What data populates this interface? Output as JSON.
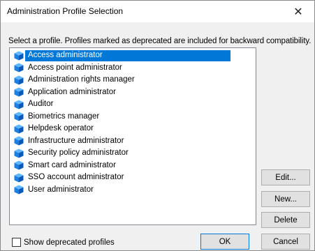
{
  "window": {
    "title": "Administration Profile Selection"
  },
  "instructions": "Select a profile.  Profiles marked as deprecated are included for backward compatibility.",
  "profiles": [
    {
      "label": "Access administrator",
      "selected": true
    },
    {
      "label": "Access point administrator"
    },
    {
      "label": "Administration rights manager"
    },
    {
      "label": "Application administrator"
    },
    {
      "label": "Auditor"
    },
    {
      "label": "Biometrics manager"
    },
    {
      "label": "Helpdesk operator"
    },
    {
      "label": "Infrastructure administrator"
    },
    {
      "label": "Security policy administrator"
    },
    {
      "label": "Smart card administrator"
    },
    {
      "label": "SSO account administrator"
    },
    {
      "label": "User administrator"
    }
  ],
  "buttons": {
    "edit": "Edit...",
    "new": "New...",
    "delete": "Delete",
    "ok": "OK",
    "cancel": "Cancel"
  },
  "show_deprecated": {
    "label": "Show deprecated profiles",
    "checked": false
  },
  "colors": {
    "selection": "#0078d7",
    "cube": "#1e90ff"
  },
  "icons": {
    "close": "close-icon",
    "profile": "profile-cube-icon"
  }
}
